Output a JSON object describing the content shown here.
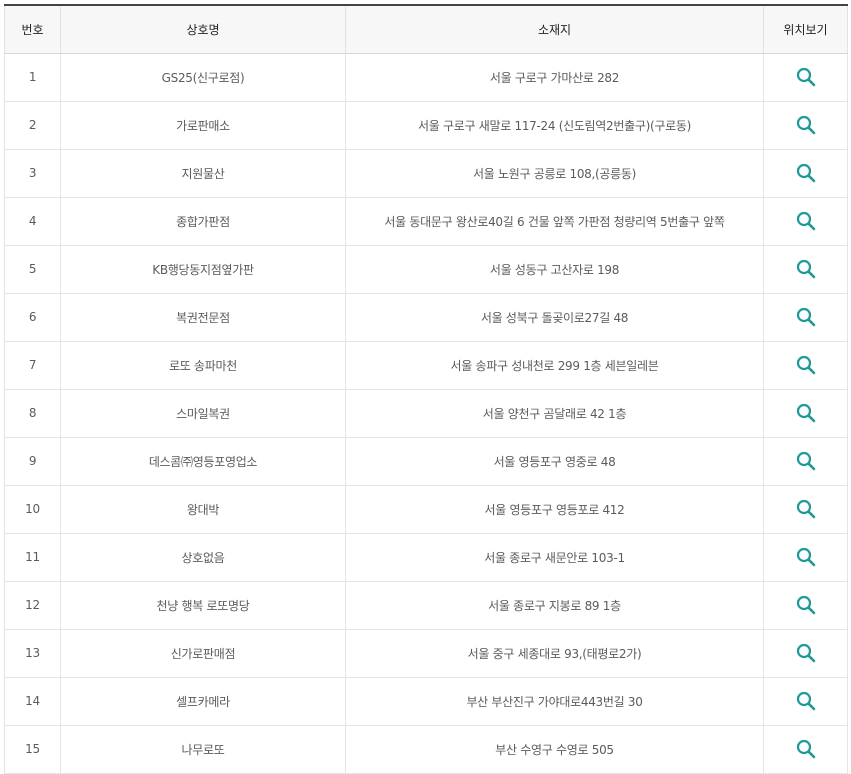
{
  "header": {
    "num": "번호",
    "name": "상호명",
    "address": "소재지",
    "location": "위치보기"
  },
  "icon": {
    "name": "search-icon",
    "color": "#1d9a94"
  },
  "rows": [
    {
      "num": "1",
      "name": "GS25(신구로점)",
      "address": "서울 구로구 가마산로 282"
    },
    {
      "num": "2",
      "name": "가로판매소",
      "address": "서울 구로구 새말로 117-24 (신도림역2번출구)(구로동)"
    },
    {
      "num": "3",
      "name": "지원물산",
      "address": "서울 노원구 공릉로 108,(공릉동)"
    },
    {
      "num": "4",
      "name": "종합가판점",
      "address": "서울 동대문구 왕산로40길 6 건물 앞쪽 가판점 청량리역 5번출구 앞쪽"
    },
    {
      "num": "5",
      "name": "KB행당동지점옆가판",
      "address": "서울 성동구 고산자로 198"
    },
    {
      "num": "6",
      "name": "복권전문점",
      "address": "서울 성북구 돌곶이로27길 48"
    },
    {
      "num": "7",
      "name": "로또 송파마천",
      "address": "서울 송파구 성내천로 299 1층 세븐일레븐"
    },
    {
      "num": "8",
      "name": "스마일복권",
      "address": "서울 양천구 곰달래로 42 1층"
    },
    {
      "num": "9",
      "name": "데스콤㈜영등포영업소",
      "address": "서울 영등포구 영중로 48"
    },
    {
      "num": "10",
      "name": "왕대박",
      "address": "서울 영등포구 영등포로 412"
    },
    {
      "num": "11",
      "name": "상호없음",
      "address": "서울 종로구 새문안로 103-1"
    },
    {
      "num": "12",
      "name": "천냥 행복 로또명당",
      "address": "서울 종로구 지봉로 89 1층"
    },
    {
      "num": "13",
      "name": "신가로판매점",
      "address": "서울 중구 세종대로 93,(태평로2가)"
    },
    {
      "num": "14",
      "name": "셀프카메라",
      "address": "부산 부산진구 가야대로443번길 30"
    },
    {
      "num": "15",
      "name": "나무로또",
      "address": "부산 수영구 수영로 505"
    }
  ]
}
